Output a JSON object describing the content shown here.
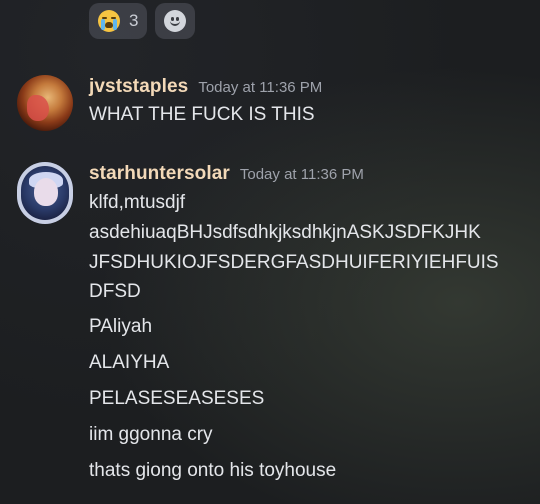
{
  "reactions": [
    {
      "emoji": "loudly-crying-face",
      "count": "3"
    }
  ],
  "add_reaction_icon": "add-reaction-smile-icon",
  "messages": [
    {
      "username": "jvststaples",
      "timestamp": "Today at 11:36 PM",
      "lines": [
        "WHAT THE FUCK IS THIS"
      ]
    },
    {
      "username": "starhuntersolar",
      "timestamp": "Today at 11:36 PM",
      "lines": [
        "klfd,mtusdjf",
        "asdehiuaqBHJsdfsdhkjksdhkjnASKJSDFKJHK",
        "JFSDHUKIOJFSDERGFASDHUIFERIYIEHFUIS",
        "DFSD",
        "PAliyah",
        "ALAIYHA",
        "PELASESEASESES",
        "iim ggonna cry",
        "thats giong onto his toyhouse"
      ]
    }
  ],
  "colors": {
    "background": "#1c1e20",
    "username": "#f3d9b8",
    "message_text": "#e4e6ea",
    "timestamp": "#9ea2ab",
    "reaction_bg": "#464850"
  }
}
